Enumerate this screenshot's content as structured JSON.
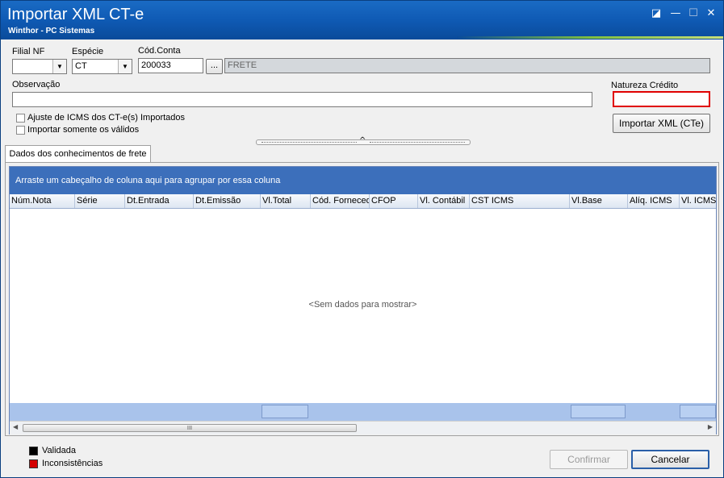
{
  "window": {
    "title": "Importar XML CT-e",
    "subtitle": "Winthor - PC Sistemas",
    "controls": {
      "restore": "◪",
      "minimize": "—",
      "maximize": "☐",
      "close": "✕"
    }
  },
  "form": {
    "filial_nf": {
      "label": "Filial NF",
      "value": ""
    },
    "especie": {
      "label": "Espécie",
      "value": "CT"
    },
    "cod_conta": {
      "label": "Cód.Conta",
      "value": "200033",
      "lookup_button": "...",
      "description": "FRETE"
    },
    "observacao": {
      "label": "Observação",
      "value": ""
    },
    "natureza_credito": {
      "label": "Natureza Crédito",
      "value": ""
    },
    "chk_ajuste_icms": {
      "label": "Ajuste de ICMS dos CT-e(s) Importados",
      "checked": false
    },
    "chk_somente_validos": {
      "label": "Importar somente os válidos",
      "checked": false
    },
    "import_button": "Importar XML (CTe)"
  },
  "tabs": [
    {
      "label": "Dados dos conhecimentos de frete",
      "active": true
    }
  ],
  "grid": {
    "group_panel_text": "Arraste um cabeçalho de coluna aqui para agrupar por essa coluna",
    "columns": [
      "Núm.Nota",
      "Série",
      "Dt.Entrada",
      "Dt.Emissão",
      "Vl.Total",
      "Cód. Fornecedor",
      "CFOP",
      "Vl. Contábil",
      "CST ICMS",
      "Vl.Base",
      "Alíq. ICMS",
      "Vl. ICMS"
    ],
    "empty_text": "<Sem dados para mostrar>",
    "scroll_grip": "III"
  },
  "legend": [
    {
      "label": "Validada",
      "color": "#000000"
    },
    {
      "label": "Inconsistências",
      "color": "#d40000"
    }
  ],
  "buttons": {
    "confirm": "Confirmar",
    "cancel": "Cancelar"
  },
  "colors": {
    "titlebar": "#0f5ab4",
    "group_panel": "#3c6fbb",
    "required_border": "#e00000"
  }
}
